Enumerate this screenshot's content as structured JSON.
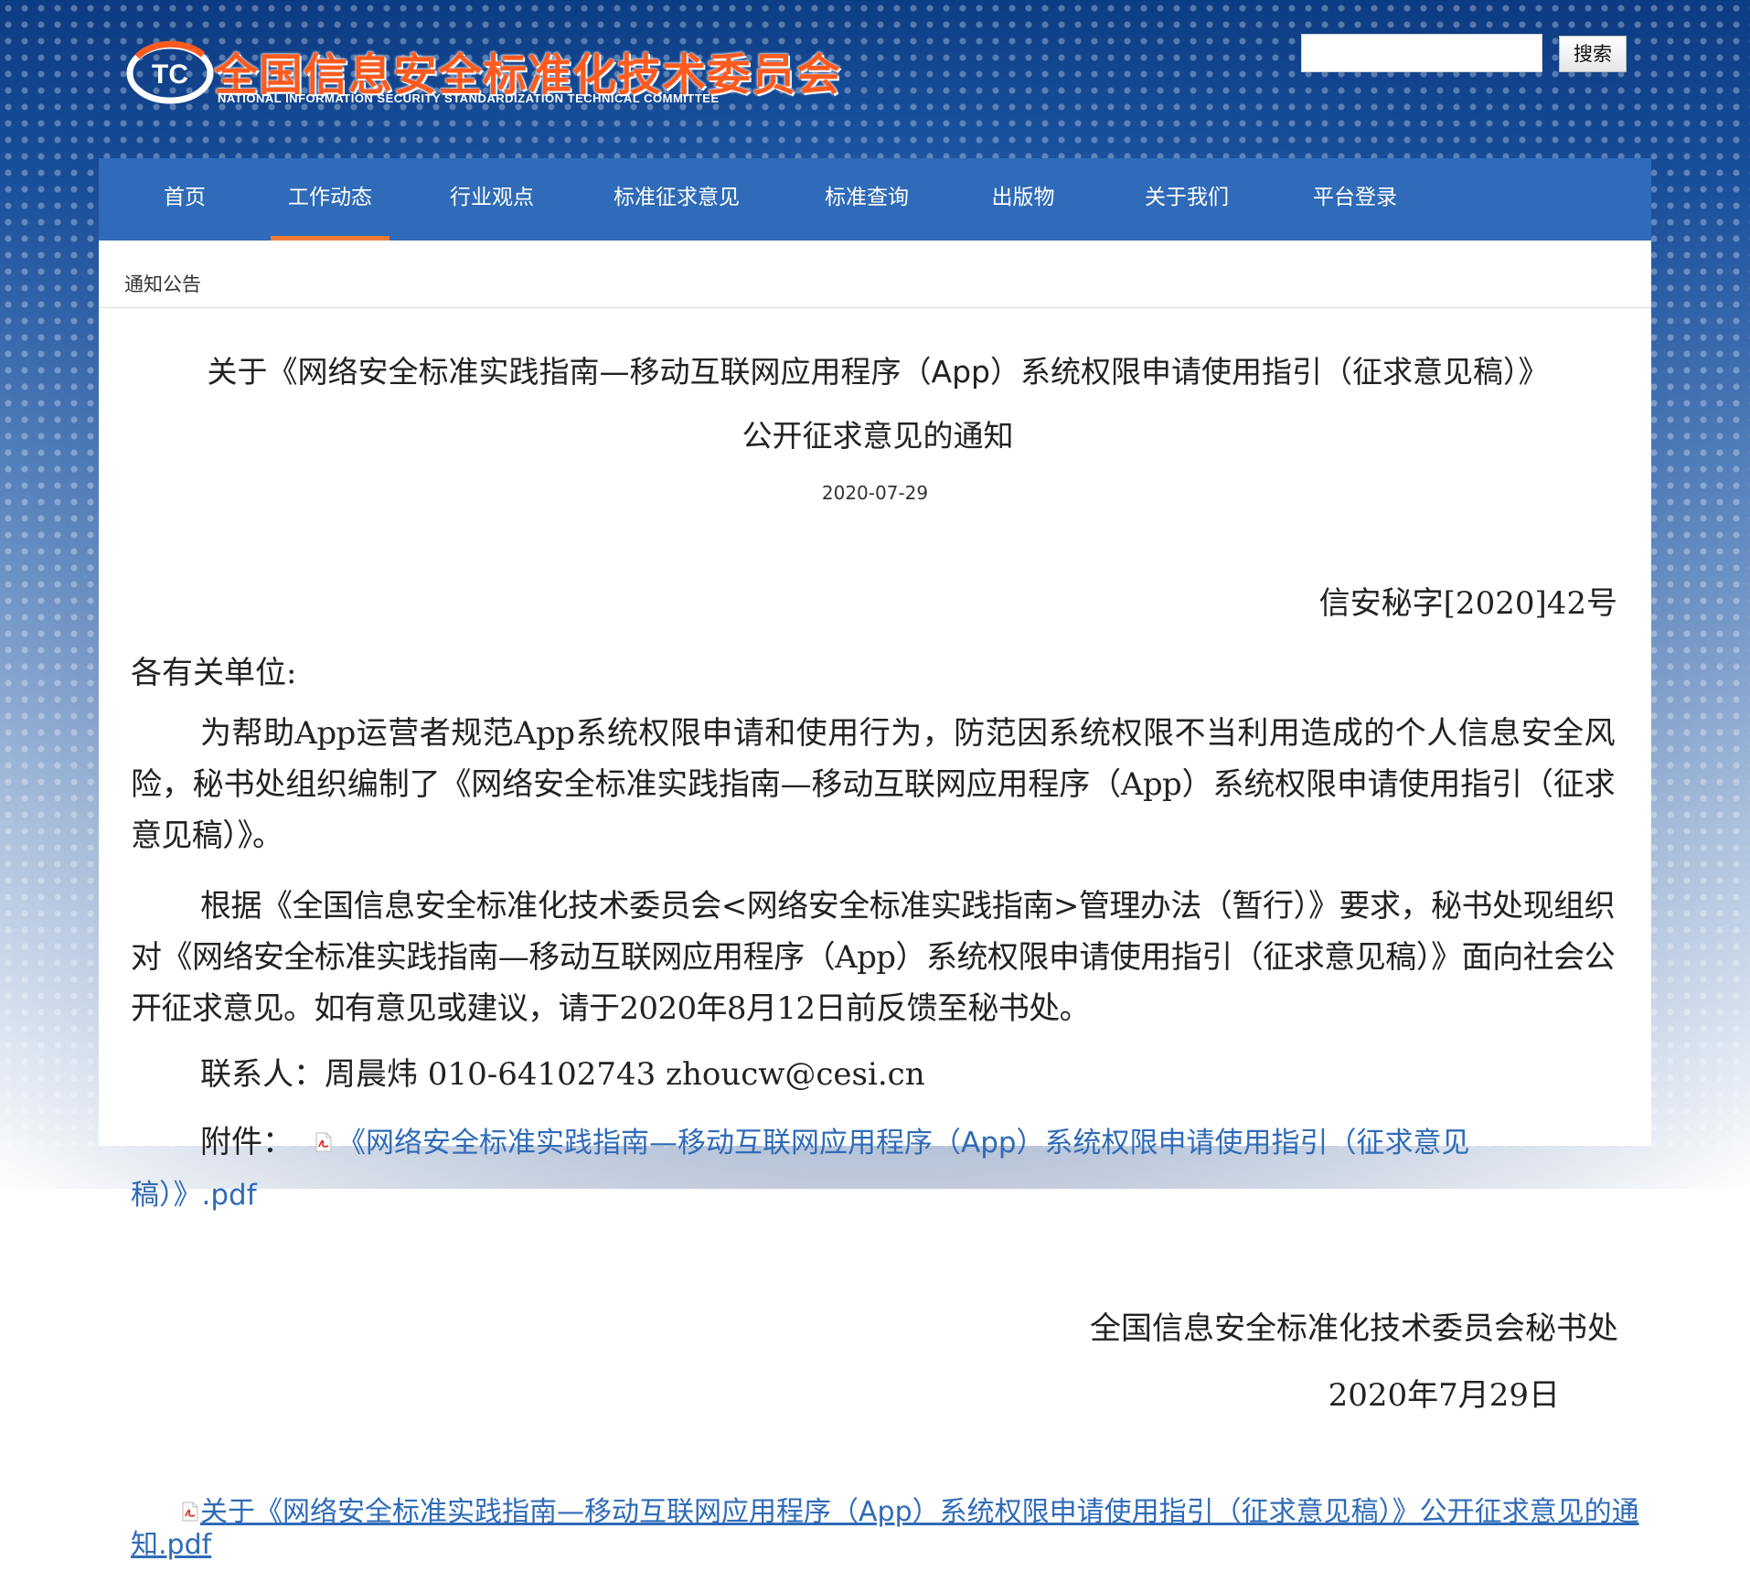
{
  "header": {
    "logo_cn": "全国信息安全标准化技术委员会",
    "logo_en": "NATIONAL INFORMATION SECURITY STANDARDIZATION TECHNICAL COMMITTEE",
    "logo_mark_text": "TC",
    "search_placeholder": "",
    "search_button": "搜索"
  },
  "nav": {
    "items": [
      {
        "label": "首页"
      },
      {
        "label": "工作动态"
      },
      {
        "label": "行业观点"
      },
      {
        "label": "标准征求意见"
      },
      {
        "label": "标准查询"
      },
      {
        "label": "出版物"
      },
      {
        "label": "关于我们"
      },
      {
        "label": "平台登录"
      }
    ],
    "active": "工作动态"
  },
  "breadcrumb": "通知公告",
  "article": {
    "title_line1": "关于《网络安全标准实践指南—移动互联网应用程序（App）系统权限申请使用指引（征求意见稿）》",
    "title_line2": "公开征求意见的通知",
    "date": "2020-07-29",
    "doc_no": "信安秘字[2020]42号",
    "greeting": "各有关单位:",
    "paragraph1": "为帮助App运营者规范App系统权限申请和使用行为，防范因系统权限不当利用造成的个人信息安全风险，秘书处组织编制了《网络安全标准实践指南—移动互联网应用程序（App）系统权限申请使用指引（征求意见稿）》。",
    "paragraph2": "根据《全国信息安全标准化技术委员会<网络安全标准实践指南>管理办法（暂行）》要求，秘书处现组织对《网络安全标准实践指南—移动互联网应用程序（App）系统权限申请使用指引（征求意见稿）》面向社会公开征求意见。如有意见或建议，请于2020年8月12日前反馈至秘书处。",
    "contact": "联系人：周晨炜  010-64102743  zhoucw@cesi.cn",
    "attachment_label": "附件：",
    "attachment_link": "《网络安全标准实践指南—移动互联网应用程序（App）系统权限申请使用指引（征求意见稿）》.pdf",
    "sign_org": "全国信息安全标准化技术委员会秘书处",
    "sign_date": "2020年7月29日",
    "bottom_link": "关于《网络安全标准实践指南—移动互联网应用程序（App）系统权限申请使用指引（征求意见稿）》公开征求意见的通知.pdf"
  },
  "colors": {
    "nav_bg": "#2f6bb8",
    "nav_active_underline": "#f07a34",
    "logo_orange": "#ff5a1f",
    "link": "#2f6bb8"
  },
  "icons": {
    "pdf": "pdf-file-icon"
  }
}
